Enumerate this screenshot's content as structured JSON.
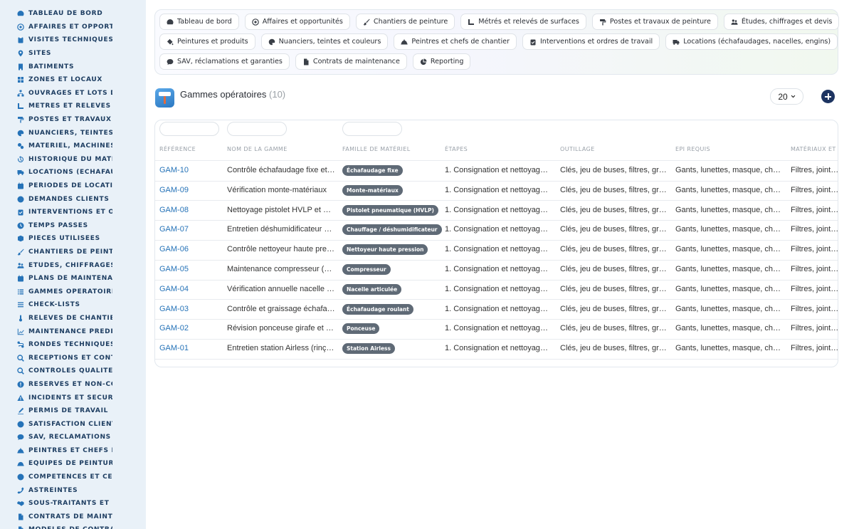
{
  "sidebar": {
    "items": [
      {
        "label": "TABLEAU DE BORD",
        "icon": "dashboard-icon"
      },
      {
        "label": "AFFAIRES ET OPPORTUNITÉS",
        "icon": "target-icon"
      },
      {
        "label": "VISITES TECHNIQUES ET",
        "icon": "clipboard-icon"
      },
      {
        "label": "SITES",
        "icon": "pin-icon"
      },
      {
        "label": "BÂTIMENTS",
        "icon": "building-icon"
      },
      {
        "label": "ZONES ET LOCAUX",
        "icon": "grid-icon"
      },
      {
        "label": "OUVRAGES ET LOTS DE T",
        "icon": "hierarchy-icon"
      },
      {
        "label": "MÉTRÉS ET RELEVÉS DE",
        "icon": "ruler-icon"
      },
      {
        "label": "POSTES ET TRAVAUX DE",
        "icon": "roller-icon"
      },
      {
        "label": "NUANCIERS, TEINTES ET",
        "icon": "palette-icon"
      },
      {
        "label": "MATÉRIEL, MACHINES ET",
        "icon": "gears-icon"
      },
      {
        "label": "HISTORIQUE DU MATÉRIEL",
        "icon": "history-icon"
      },
      {
        "label": "LOCATIONS (ÉCHAFAUDA",
        "icon": "truck-icon"
      },
      {
        "label": "PÉRIODES DE LOCATION",
        "icon": "calendar-icon"
      },
      {
        "label": "DEMANDES CLIENTS ET I",
        "icon": "question-icon"
      },
      {
        "label": "INTERVENTIONS ET ORDI",
        "icon": "clipboard-check-icon"
      },
      {
        "label": "TEMPS PASSÉS",
        "icon": "clock-icon"
      },
      {
        "label": "PIÈCES UTILISÉES",
        "icon": "box-icon"
      },
      {
        "label": "CHANTIERS DE PEINTURI",
        "icon": "brush-icon"
      },
      {
        "label": "ÉTUDES, CHIFFRAGES ET",
        "icon": "people-icon"
      },
      {
        "label": "PLANS DE MAINTENANCE",
        "icon": "calendar-icon"
      },
      {
        "label": "GAMMES OPÉRATOIRES",
        "icon": "list-icon"
      },
      {
        "label": "CHECK-LISTS",
        "icon": "checklist-icon"
      },
      {
        "label": "RELEVÉS DE CHANTIER",
        "icon": "thermometer-icon"
      },
      {
        "label": "MAINTENANCE PRÉDICTIVE",
        "icon": "chart-icon"
      },
      {
        "label": "RONDES TECHNIQUES",
        "icon": "route-icon"
      },
      {
        "label": "RÉCEPTIONS ET CONTRÔ",
        "icon": "search-icon"
      },
      {
        "label": "CONTRÔLES QUALITÉ ET",
        "icon": "magnifier-icon"
      },
      {
        "label": "RÉSERVES ET NON-CONF",
        "icon": "alert-circle-icon"
      },
      {
        "label": "INCIDENTS ET SÉCURITÉ",
        "icon": "warning-icon"
      },
      {
        "label": "PERMIS DE TRAVAIL",
        "icon": "signature-icon"
      },
      {
        "label": "SATISFACTION CLIENT",
        "icon": "smile-icon"
      },
      {
        "label": "SAV, RÉCLAMATIONS ET G",
        "icon": "chat-icon"
      },
      {
        "label": "PEINTRES ET CHEFS DE C",
        "icon": "helmet-icon"
      },
      {
        "label": "ÉQUIPES DE PEINTURE",
        "icon": "team-icon"
      },
      {
        "label": "COMPÉTENCES ET CERTI",
        "icon": "badge-icon"
      },
      {
        "label": "ASTREINTES",
        "icon": "phone-icon"
      },
      {
        "label": "SOUS-TRAITANTS ET FOU",
        "icon": "handshake-icon"
      },
      {
        "label": "CONTRATS DE MAINTENA",
        "icon": "document-icon"
      },
      {
        "label": "MODÈLES DE CONTRATS",
        "icon": "document-icon"
      }
    ]
  },
  "tabs": {
    "rows": [
      [
        {
          "label": "Tableau de bord",
          "icon": "dashboard-icon"
        },
        {
          "label": "Affaires et opportunités",
          "icon": "target-icon"
        },
        {
          "label": "Chantiers de peinture",
          "icon": "brush-icon"
        },
        {
          "label": "Métrés et relevés de surfaces",
          "icon": "ruler-icon"
        },
        {
          "label": "Postes et travaux de peinture",
          "icon": "roller-icon"
        },
        {
          "label": "Études, chiffrages et devis",
          "icon": "people-icon"
        }
      ],
      [
        {
          "label": "Peintures et produits",
          "icon": "paint-bucket-icon"
        },
        {
          "label": "Nuanciers, teintes et couleurs",
          "icon": "palette-icon"
        },
        {
          "label": "Peintres et chefs de chantier",
          "icon": "helmet-icon"
        },
        {
          "label": "Interventions et ordres de travail",
          "icon": "clipboard-check-icon"
        },
        {
          "label": "Locations (échafaudages, nacelles, engins)",
          "icon": "truck-icon"
        }
      ],
      [
        {
          "label": "SAV, réclamations et garanties",
          "icon": "chat-icon"
        },
        {
          "label": "Contrats de maintenance",
          "icon": "document-icon"
        },
        {
          "label": "Reporting",
          "icon": "pie-icon"
        }
      ]
    ]
  },
  "page": {
    "title": "Gammes opératoires",
    "count": "(10)",
    "page_size": "20"
  },
  "table": {
    "columns": [
      "RÉFÉRENCE",
      "NOM DE LA GAMME",
      "FAMILLE DE MATÉRIEL",
      "ÉTAPES",
      "OUTILLAGE",
      "EPI REQUIS",
      "MATÉRIAUX ET C"
    ],
    "rows": [
      {
        "ref": "GAM-10",
        "name": "Contrôle échafaudage fixe et …",
        "family": "Échafaudage fixe",
        "steps": "1. Consignation et nettoyage\\…",
        "tools": "Clés, jeu de buses, filtres, gra…",
        "epi": "Gants, lunettes, masque, cha…",
        "materials": "Filtres, joints, b"
      },
      {
        "ref": "GAM-09",
        "name": "Vérification monte-matériaux",
        "family": "Monte-matériaux",
        "steps": "1. Consignation et nettoyage\\…",
        "tools": "Clés, jeu de buses, filtres, gra…",
        "epi": "Gants, lunettes, masque, cha…",
        "materials": "Filtres, joints, b"
      },
      {
        "ref": "GAM-08",
        "name": "Nettoyage pistolet HVLP et b…",
        "family": "Pistolet pneumatique (HVLP)",
        "steps": "1. Consignation et nettoyage\\…",
        "tools": "Clés, jeu de buses, filtres, gra…",
        "epi": "Gants, lunettes, masque, cha…",
        "materials": "Filtres, joints, b"
      },
      {
        "ref": "GAM-07",
        "name": "Entretien déshumidificateur d…",
        "family": "Chauffage / déshumidificateur",
        "steps": "1. Consignation et nettoyage\\…",
        "tools": "Clés, jeu de buses, filtres, gra…",
        "epi": "Gants, lunettes, masque, cha…",
        "materials": "Filtres, joints, b"
      },
      {
        "ref": "GAM-06",
        "name": "Contrôle nettoyeur haute pres…",
        "family": "Nettoyeur haute pression",
        "steps": "1. Consignation et nettoyage\\…",
        "tools": "Clés, jeu de buses, filtres, gra…",
        "epi": "Gants, lunettes, masque, cha…",
        "materials": "Filtres, joints, b"
      },
      {
        "ref": "GAM-05",
        "name": "Maintenance compresseur (vi…",
        "family": "Compresseur",
        "steps": "1. Consignation et nettoyage\\…",
        "tools": "Clés, jeu de buses, filtres, gra…",
        "epi": "Gants, lunettes, masque, cha…",
        "materials": "Filtres, joints, b"
      },
      {
        "ref": "GAM-04",
        "name": "Vérification annuelle nacelle …",
        "family": "Nacelle articulée",
        "steps": "1. Consignation et nettoyage\\…",
        "tools": "Clés, jeu de buses, filtres, gra…",
        "epi": "Gants, lunettes, masque, cha…",
        "materials": "Filtres, joints, b"
      },
      {
        "ref": "GAM-03",
        "name": "Contrôle et graissage échafa…",
        "family": "Échafaudage roulant",
        "steps": "1. Consignation et nettoyage\\…",
        "tools": "Clés, jeu de buses, filtres, gra…",
        "epi": "Gants, lunettes, masque, cha…",
        "materials": "Filtres, joints, b"
      },
      {
        "ref": "GAM-02",
        "name": "Révision ponceuse girafe et a…",
        "family": "Ponceuse",
        "steps": "1. Consignation et nettoyage\\…",
        "tools": "Clés, jeu de buses, filtres, gra…",
        "epi": "Gants, lunettes, masque, cha…",
        "materials": "Filtres, joints, b"
      },
      {
        "ref": "GAM-01",
        "name": "Entretien station Airless (rinça…",
        "family": "Station Airless",
        "steps": "1. Consignation et nettoyage\\…",
        "tools": "Clés, jeu de buses, filtres, gra…",
        "epi": "Gants, lunettes, masque, cha…",
        "materials": "Filtres, joints, b"
      }
    ]
  },
  "colors": {
    "sidebar_bg": "#e9f1f8",
    "sidebar_text": "#1d3d61",
    "icon_blue": "#2673b8",
    "link": "#2673b8",
    "badge_bg": "#5f6a76",
    "add_button": "#1d3461"
  }
}
